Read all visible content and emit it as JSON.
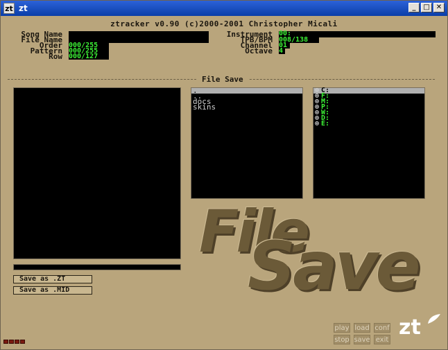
{
  "window": {
    "title": "zt",
    "icon": "zt-app-icon",
    "controls": [
      "_",
      "□",
      "✕"
    ]
  },
  "header": {
    "title": "ztracker v0.90 (c)2000-2001 Christopher Micali"
  },
  "song": {
    "song_name_label": "Song Name",
    "song_name": "",
    "file_name_label": "File Name",
    "file_name": "",
    "order_label": "Order",
    "order": "000/255",
    "pattern_label": "Pattern",
    "pattern": "000/255",
    "row_label": "Row",
    "row": "000/127"
  },
  "instrument": {
    "instrument_label": "Instrument",
    "instrument": "00:",
    "tpb_label": "TPB/BPM",
    "tpb": "008/138",
    "channel_label": "Channel",
    "channel": "01",
    "octave_label": "Octave",
    "octave": "4"
  },
  "section": {
    "title": "File Save"
  },
  "files": [
    ".",
    "..",
    "docs",
    "skins"
  ],
  "drives": [
    "C:",
    "F:",
    "M:",
    "P:",
    "W:",
    "D:",
    "E:"
  ],
  "drive_icon": "drive-icon",
  "filename_input": {
    "value": ""
  },
  "buttons": {
    "save_zt": "Save as .ZT",
    "save_mid": "Save as .MID"
  },
  "decor": {
    "word1": "File",
    "word2": "Save"
  },
  "controls": {
    "play": "play",
    "load": "load",
    "conf": "conf",
    "stop": "stop",
    "save": "save",
    "exit": "exit"
  },
  "logo": "zt",
  "colors": {
    "background": "#b9a57c",
    "value_green": "#3cf035",
    "title_bar": "#0a3ea8"
  }
}
